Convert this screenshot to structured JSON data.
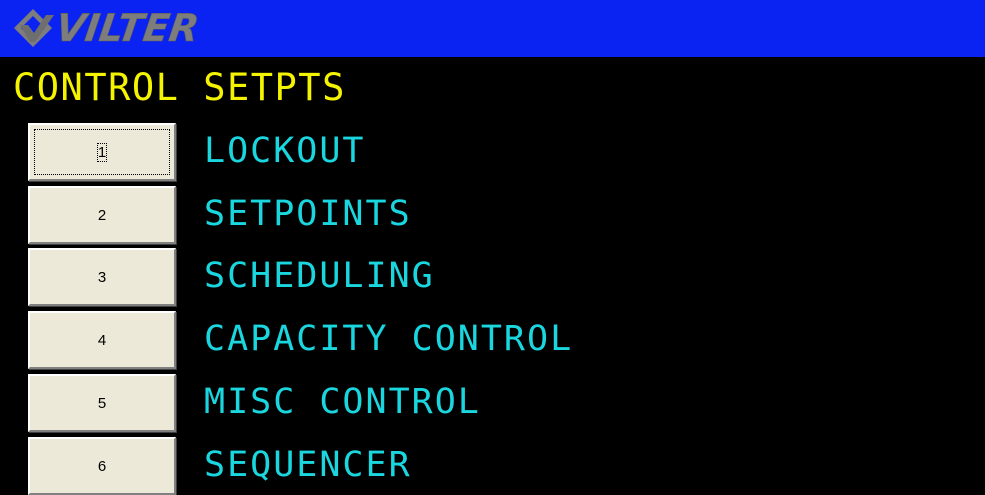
{
  "header": {
    "brand": "VILTER",
    "background_color": "#0B23F2",
    "logo_icon": "vilter-diamond-logo-icon"
  },
  "screen": {
    "title": "CONTROL SETPTS",
    "title_color": "#F4F400",
    "item_color": "#19D6DF",
    "background_color": "#000000"
  },
  "menu": {
    "items": [
      {
        "key": "1",
        "label": "LOCKOUT",
        "focused": true
      },
      {
        "key": "2",
        "label": "SETPOINTS"
      },
      {
        "key": "3",
        "label": "SCHEDULING"
      },
      {
        "key": "4",
        "label": "CAPACITY CONTROL"
      },
      {
        "key": "5",
        "label": "MISC CONTROL"
      },
      {
        "key": "6",
        "label": "SEQUENCER"
      }
    ]
  }
}
